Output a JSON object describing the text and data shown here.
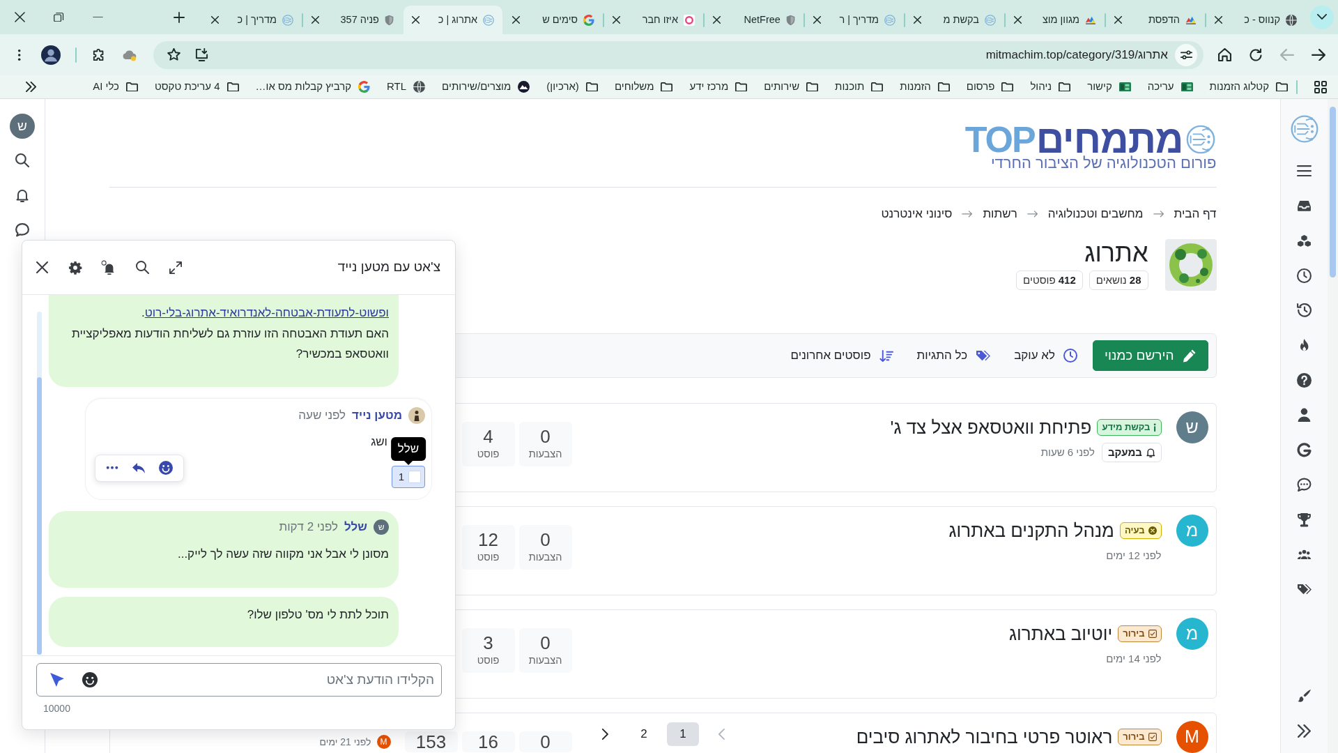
{
  "browser": {
    "tabs": [
      {
        "title": "קנווס - כ",
        "kind": "globe",
        "selected": false
      },
      {
        "title": "הדפסת",
        "kind": "print",
        "selected": false
      },
      {
        "title": "מגוון מוצ",
        "kind": "print",
        "selected": false
      },
      {
        "title": "בקשת מ",
        "kind": "forum",
        "selected": false
      },
      {
        "title": "מדריך | ר",
        "kind": "forum",
        "selected": false
      },
      {
        "title": "NetFree",
        "kind": "shield",
        "selected": false
      },
      {
        "title": "איזו חבר",
        "kind": "ring",
        "selected": false
      },
      {
        "title": "סימים ש",
        "kind": "google",
        "selected": false
      },
      {
        "title": "אתרוג | כ",
        "kind": "forum",
        "selected": true
      },
      {
        "title": "פניה 357",
        "kind": "shield",
        "selected": false
      },
      {
        "title": "מדריך | כ",
        "kind": "forum",
        "selected": false
      }
    ],
    "back": {
      "disabled": false
    },
    "forward": {
      "disabled": true
    },
    "address": {
      "url": "mitmachim.top/category/319/אתרוג"
    },
    "bookmarks": [
      {
        "label": "קטלוג הזמנות",
        "kind": "folder"
      },
      {
        "label": "עריכה",
        "kind": "sheet"
      },
      {
        "label": "קישור",
        "kind": "sheet"
      },
      {
        "label": "ניהול",
        "kind": "folder"
      },
      {
        "label": "פרסום",
        "kind": "folder"
      },
      {
        "label": "הזמנות",
        "kind": "folder"
      },
      {
        "label": "תוכנות",
        "kind": "folder"
      },
      {
        "label": "שירותים",
        "kind": "folder"
      },
      {
        "label": "מרכז ידע",
        "kind": "folder"
      },
      {
        "label": "משלוחים",
        "kind": "folder"
      },
      {
        "label": "(ארכיון)",
        "kind": "folder"
      },
      {
        "label": "מוצרים/שירותים",
        "kind": "logo"
      },
      {
        "label": "RTL",
        "kind": "globe"
      },
      {
        "label": "קרביץ קבלות מס או…",
        "kind": "google"
      },
      {
        "label": "4 עריכת טקסט",
        "kind": "folder"
      },
      {
        "label": "כלי AI",
        "kind": "folder"
      }
    ]
  },
  "user": {
    "avatar": "ש"
  },
  "header": {
    "logo": "מתמחים",
    "logo_accent": "TOP",
    "tagline": "פורום הטכנולוגיה של הציבור החרדי"
  },
  "breadcrumbs": [
    "דף הבית",
    "מחשבים וטכנולוגיה",
    "רשתות",
    "סינוני אינטרנט"
  ],
  "category": {
    "title": "אתרוג",
    "counts": [
      {
        "value": "28",
        "label": "נושאים"
      },
      {
        "value": "412",
        "label": "פוסטים"
      }
    ]
  },
  "toolbar": [
    {
      "kind": "subscribe",
      "label": "הירשם כמנוי"
    },
    {
      "kind": "watch",
      "label": "לא עוקב"
    },
    {
      "kind": "tags",
      "label": "כל התגיות"
    },
    {
      "kind": "sort",
      "label": "פוסטים אחרונים"
    }
  ],
  "topics": [
    {
      "avatar": "ש",
      "color": "#607d8b",
      "tag": {
        "label": "בקשת מידע",
        "kind": "info"
      },
      "title": "פתיחת וואטסאפ אצל צד ג'",
      "watching": "במעקב",
      "time": "לפני 6 שעות",
      "stats": [
        {
          "value": "0",
          "label": "הצבעות"
        },
        {
          "value": "4",
          "label": "פוסט"
        }
      ]
    },
    {
      "avatar": "מ",
      "color": "#26b6cf",
      "tag": {
        "label": "בעיה",
        "kind": "problem"
      },
      "title": "מנהל התקנים באתרוג",
      "time": "לפני 12 ימים",
      "stats": [
        {
          "value": "0",
          "label": "הצבעות"
        },
        {
          "value": "12",
          "label": "פוסט"
        }
      ]
    },
    {
      "avatar": "מ",
      "color": "#26b6cf",
      "tag": {
        "label": "בירור",
        "kind": "clarify"
      },
      "title": "יוטיוב באתרוג",
      "time": "לפני 14 ימים",
      "stats": [
        {
          "value": "0",
          "label": "הצבעות"
        },
        {
          "value": "3",
          "label": "פוסט"
        }
      ]
    },
    {
      "avatar": "M",
      "color": "#e65100",
      "tag": {
        "label": "בירור",
        "kind": "clarify"
      },
      "title": "ראוטר פרטי בחיבור לאתרוג סיבים",
      "stats": [
        {
          "value": "0"
        },
        {
          "value": "16"
        },
        {
          "value": "153"
        }
      ],
      "teaser": {
        "avatar": "M",
        "color": "#e65100",
        "time": "לפני 21 ימים"
      }
    }
  ],
  "pagination": {
    "prev": {
      "disabled": true
    },
    "pages": [
      {
        "label": "1",
        "selected": true
      },
      {
        "label": "2",
        "selected": false
      }
    ],
    "next": {
      "disabled": false
    }
  },
  "chat": {
    "title": "צ'אט עם",
    "partner": "מטען נייד",
    "messages": [
      {
        "kind": "own",
        "link": "ופשוט-לתעודת-אבטחה-לאנדרואיד-אתרוג-בלי-רוט",
        "link_suffix": ".",
        "text": "האם תעודת האבטחה הזו עוזרת גם לשליחת הודעות מאפליקציית וואטסאפ במכשיר?"
      },
      {
        "kind": "other",
        "author": "מטען נייד",
        "time": "לפני שעה",
        "text": "ושג",
        "hovered": true,
        "reactions": [
          {
            "count": "1",
            "tooltip": "שלל",
            "reacted": true
          }
        ]
      },
      {
        "kind": "own",
        "author": "שלל",
        "avatar": "ש",
        "time": "לפני 2 דקות",
        "text": "מסונן לי אבל אני מקווה שזה עשה לך לייק..."
      },
      {
        "kind": "own",
        "text": "תוכל לתת לי מס' טלפון שלו?"
      }
    ],
    "composer": {
      "placeholder": "הקלידו הודעת צ'אט",
      "limit": "10000"
    }
  }
}
